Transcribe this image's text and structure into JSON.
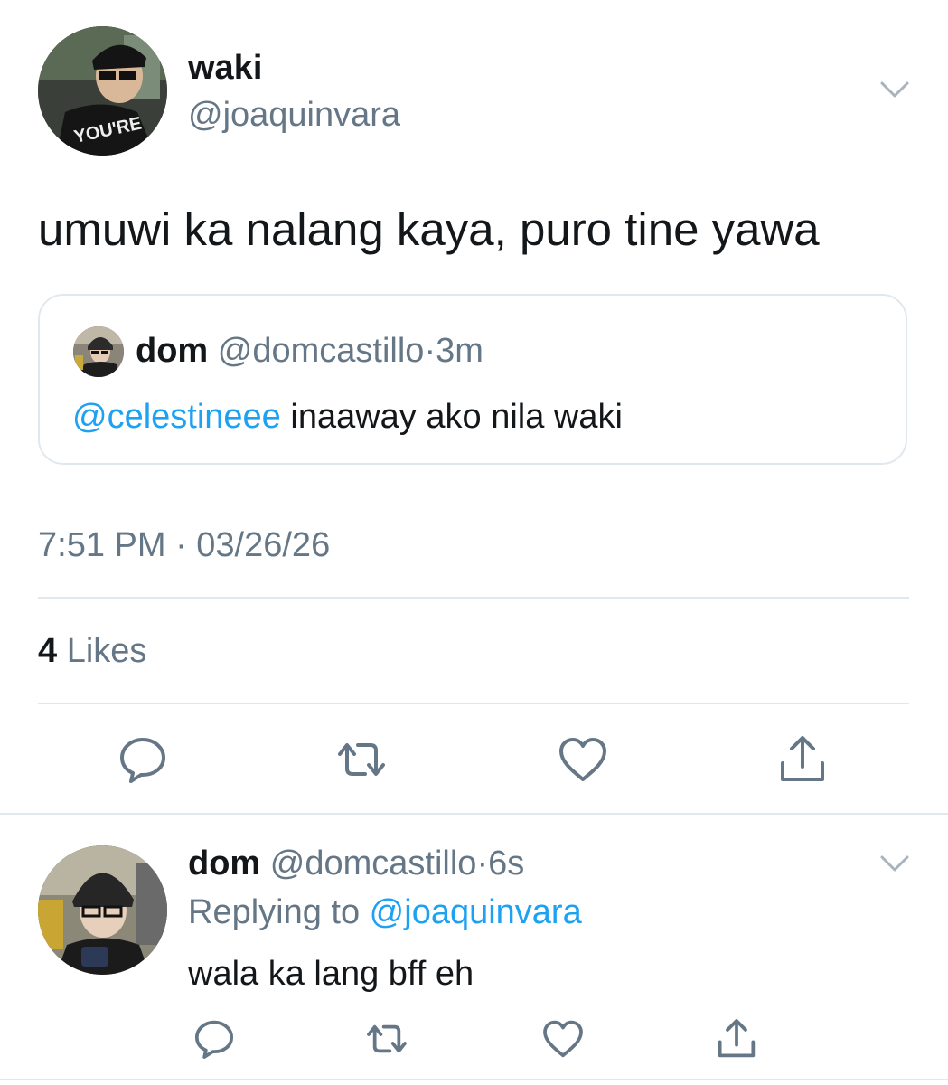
{
  "main_tweet": {
    "author_name": "waki",
    "author_handle": "@joaquinvara",
    "avatar_icon": "user-photo",
    "text": "umuwi ka nalang kaya, puro tine yawa",
    "timestamp": "7:51 PM · 03/26/26",
    "likes_count": "4",
    "likes_label": "Likes",
    "quoted": {
      "author_name": "dom",
      "author_handle": "@domcastillo",
      "separator": "·",
      "time": "3m",
      "mention": "@celestineee",
      "text": " inaaway ako nila waki"
    },
    "actions": [
      "reply-icon",
      "retweet-icon",
      "like-icon",
      "share-icon"
    ]
  },
  "reply_tweet": {
    "author_name": "dom",
    "author_handle": "@domcastillo",
    "separator": "·",
    "time": "6s",
    "replying_label": "Replying to ",
    "replying_handle": "@joaquinvara",
    "text": "wala ka lang bff eh",
    "actions": [
      "reply-icon",
      "retweet-icon",
      "like-icon",
      "share-icon"
    ]
  },
  "colors": {
    "text_primary": "#14171a",
    "text_secondary": "#657786",
    "link": "#1da1f2",
    "divider": "#e1e8ed"
  }
}
